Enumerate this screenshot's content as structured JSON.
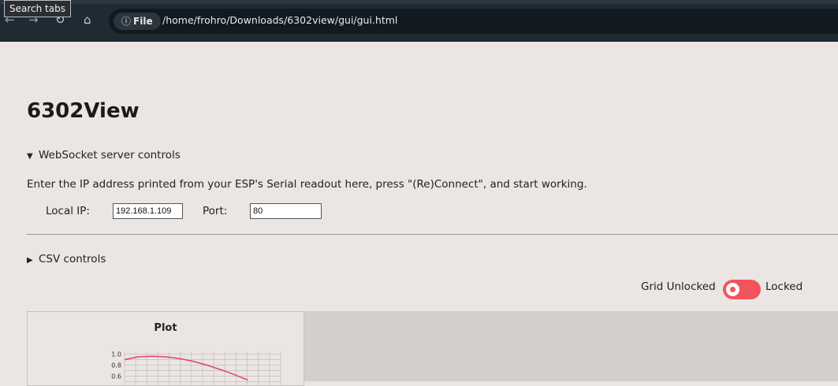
{
  "browser": {
    "tooltip": "Search tabs",
    "nav_icons": [
      "back-icon",
      "forward-icon",
      "reload-icon",
      "home-icon"
    ],
    "file_chip": "File",
    "url": "/home/frohro/Downloads/6302view/gui/gui.html"
  },
  "page": {
    "title": "6302View",
    "websocket": {
      "summary": "WebSocket server controls",
      "expanded": true,
      "instructions": "Enter the IP address printed from your ESP's Serial readout here, press \"(Re)Connect\", and start working.",
      "ip_label": "Local IP:",
      "ip_value": "192.168.1.109",
      "port_label": "Port:",
      "port_value": "80"
    },
    "csv": {
      "summary": "CSV controls",
      "expanded": false
    },
    "grid_toggle": {
      "left_label": "Grid Unlocked",
      "right_label": "Locked",
      "state": "unlocked",
      "color": "#f2545b"
    },
    "plot_panel": {
      "title": "Plot"
    }
  },
  "chart_data": {
    "type": "line",
    "title": "Plot",
    "xlabel": "",
    "ylabel": "",
    "yticks": [
      "1.0",
      "0.8",
      "0.6"
    ],
    "x": [
      0,
      1,
      2,
      3,
      4,
      5,
      6,
      7,
      8,
      9
    ],
    "series": [
      {
        "values": [
          0.9,
          0.95,
          0.96,
          0.95,
          0.92,
          0.87,
          0.8,
          0.72,
          0.63,
          0.53
        ],
        "color": "#e0407a"
      }
    ],
    "ylim": [
      0.5,
      1.05
    ],
    "grid": true
  }
}
